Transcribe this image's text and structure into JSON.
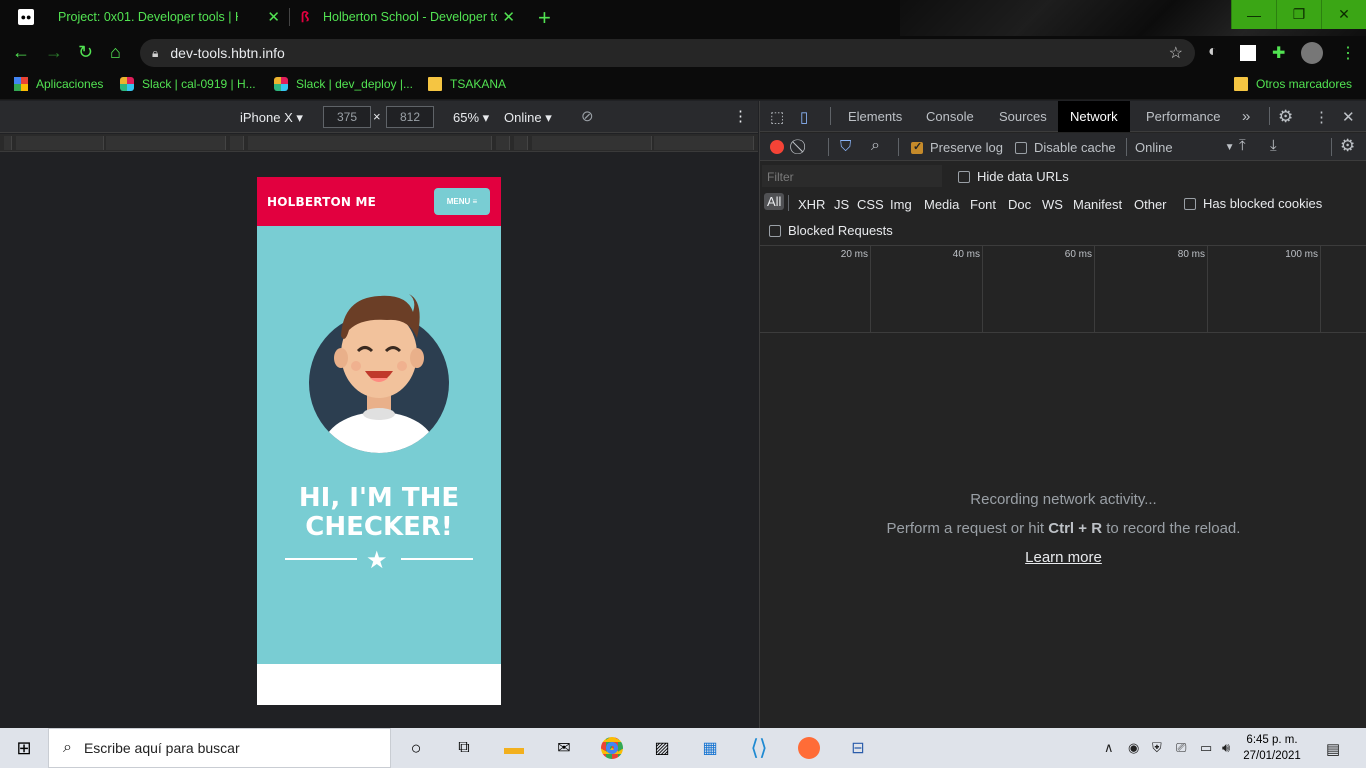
{
  "browser": {
    "tabs": [
      {
        "title": "Project: 0x01. Developer tools | H",
        "favicon": "medium-icon",
        "active": false
      },
      {
        "title": "Holberton School - Developer to",
        "favicon": "holberton-icon",
        "active": true
      }
    ],
    "address": "dev-tools.hbtn.info",
    "accent_color": "#52e352",
    "bookmarks": [
      {
        "label": "Aplicaciones",
        "icon": "apps-grid-icon"
      },
      {
        "label": "Slack | cal-0919 | H...",
        "icon": "slack-icon"
      },
      {
        "label": "Slack | dev_deploy |...",
        "icon": "slack-icon"
      },
      {
        "label": "TSAKANA",
        "icon": "folder-icon"
      }
    ],
    "other_bookmarks": "Otros marcadores"
  },
  "device_toolbar": {
    "device": "iPhone X",
    "width": "375",
    "height": "812",
    "zoom": "65%",
    "throttle": "Online"
  },
  "phone": {
    "brand": "HOLBERTON ME",
    "menu_label": "MENU ≡",
    "title_line1": "HI, I'M THE",
    "title_line2": "CHECKER!",
    "header_color": "#e2003f",
    "hero_color": "#79cdd3"
  },
  "devtools": {
    "tabs": [
      "Elements",
      "Console",
      "Sources",
      "Network",
      "Performance"
    ],
    "active_tab": "Network",
    "preserve_log": "Preserve log",
    "preserve_log_checked": true,
    "disable_cache": "Disable cache",
    "throttle": "Online",
    "filter_placeholder": "Filter",
    "hide_data_urls": "Hide data URLs",
    "filter_types": [
      "All",
      "XHR",
      "JS",
      "CSS",
      "Img",
      "Media",
      "Font",
      "Doc",
      "WS",
      "Manifest",
      "Other"
    ],
    "has_blocked_cookies": "Has blocked cookies",
    "blocked_requests": "Blocked Requests",
    "ticks": [
      "20 ms",
      "40 ms",
      "60 ms",
      "80 ms",
      "100 ms"
    ],
    "recording": "Recording network activity...",
    "hint_pre": "Perform a request or hit ",
    "hint_keys": "Ctrl + R",
    "hint_post": " to record the reload.",
    "learn_more": "Learn more"
  },
  "taskbar": {
    "search_placeholder": "Escribe aquí para buscar",
    "time": "6:45 p. m.",
    "date": "27/01/2021"
  }
}
